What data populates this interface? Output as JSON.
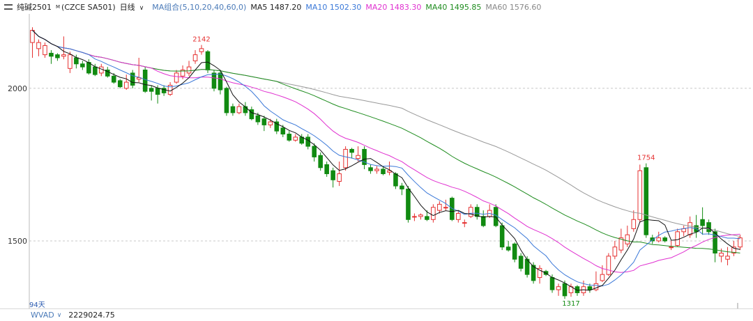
{
  "header": {
    "symbol": "纯碱2501",
    "symbol_mark": "M",
    "contract": "(CZCE SA501)",
    "period": "日线",
    "ma_group": "MA组合(5,10,20,40,60,0)",
    "ma5": "MA5 1487.20",
    "ma10": "MA10 1502.30",
    "ma20": "MA20 1483.30",
    "ma40": "MA40 1495.85",
    "ma60": "MA60 1576.60"
  },
  "footer": {
    "days": "94天",
    "indicator": "WVAD",
    "indicator_value": "2229024.75"
  },
  "colors": {
    "up": "#e53030",
    "down": "#118a11",
    "ma5": "#111111",
    "ma10": "#3a78d8",
    "ma20": "#e030d0",
    "ma40": "#1e8c1e",
    "ma60": "#999999",
    "grid": "#c8c8c8"
  },
  "chart_data": {
    "type": "candlestick",
    "title": "纯碱2501 (CZCE SA501) 日线",
    "y_ticks": [
      2000,
      1500
    ],
    "ylim": [
      1290,
      2230
    ],
    "grid": "dashed horizontal at ticks",
    "annotations": [
      {
        "text": "2142",
        "type": "high"
      },
      {
        "text": "1754",
        "type": "high"
      },
      {
        "text": "1317",
        "type": "low"
      }
    ],
    "candles": [
      [
        2150,
        2190,
        2100,
        2200
      ],
      [
        2130,
        2150,
        2105,
        2160
      ],
      [
        2110,
        2140,
        2100,
        2150
      ],
      [
        2115,
        2105,
        2080,
        2125
      ],
      [
        2110,
        2100,
        2090,
        2115
      ],
      [
        2105,
        2110,
        2095,
        2170
      ],
      [
        2065,
        2110,
        2050,
        2120
      ],
      [
        2100,
        2080,
        2065,
        2110
      ],
      [
        2080,
        2070,
        2060,
        2090
      ],
      [
        2085,
        2050,
        2045,
        2095
      ],
      [
        2070,
        2045,
        2040,
        2080
      ],
      [
        2050,
        2070,
        2040,
        2080
      ],
      [
        2060,
        2040,
        2035,
        2070
      ],
      [
        2040,
        2020,
        2015,
        2050
      ],
      [
        2025,
        2005,
        2000,
        2030
      ],
      [
        2000,
        2020,
        1995,
        2045
      ],
      [
        2050,
        2010,
        2000,
        2060
      ],
      [
        2030,
        2035,
        2020,
        2100
      ],
      [
        2060,
        1990,
        1985,
        2070
      ],
      [
        2000,
        1990,
        1960,
        2010
      ],
      [
        2000,
        1980,
        1950,
        2010
      ],
      [
        2000,
        1985,
        1975,
        2010
      ],
      [
        1980,
        2010,
        1975,
        2020
      ],
      [
        2020,
        2050,
        2015,
        2060
      ],
      [
        2040,
        2060,
        2030,
        2075
      ],
      [
        2050,
        2070,
        2040,
        2090
      ],
      [
        2090,
        2110,
        2080,
        2125
      ],
      [
        2120,
        2130,
        2110,
        2142
      ],
      [
        2120,
        2060,
        2050,
        2125
      ],
      [
        2050,
        2000,
        1990,
        2060
      ],
      [
        2050,
        1995,
        1980,
        2060
      ],
      [
        2000,
        1920,
        1910,
        2005
      ],
      [
        1940,
        1920,
        1910,
        1950
      ],
      [
        1920,
        1940,
        1915,
        1950
      ],
      [
        1940,
        1920,
        1910,
        1955
      ],
      [
        1930,
        1900,
        1895,
        1940
      ],
      [
        1910,
        1890,
        1880,
        1920
      ],
      [
        1900,
        1880,
        1860,
        1910
      ],
      [
        1880,
        1890,
        1870,
        1900
      ],
      [
        1890,
        1860,
        1850,
        1900
      ],
      [
        1870,
        1850,
        1840,
        1880
      ],
      [
        1850,
        1830,
        1825,
        1860
      ],
      [
        1830,
        1840,
        1825,
        1850
      ],
      [
        1840,
        1820,
        1815,
        1850
      ],
      [
        1840,
        1810,
        1800,
        1850
      ],
      [
        1810,
        1775,
        1760,
        1820
      ],
      [
        1780,
        1740,
        1730,
        1790
      ],
      [
        1750,
        1720,
        1710,
        1760
      ],
      [
        1730,
        1700,
        1675,
        1740
      ],
      [
        1695,
        1720,
        1680,
        1760
      ],
      [
        1740,
        1800,
        1730,
        1810
      ],
      [
        1800,
        1790,
        1770,
        1805
      ],
      [
        1770,
        1780,
        1760,
        1810
      ],
      [
        1800,
        1750,
        1735,
        1810
      ],
      [
        1740,
        1730,
        1720,
        1750
      ],
      [
        1730,
        1735,
        1720,
        1745
      ],
      [
        1735,
        1720,
        1715,
        1745
      ],
      [
        1725,
        1730,
        1715,
        1760
      ],
      [
        1720,
        1680,
        1670,
        1725
      ],
      [
        1680,
        1670,
        1650,
        1690
      ],
      [
        1670,
        1570,
        1560,
        1680
      ],
      [
        1580,
        1580,
        1565,
        1590
      ],
      [
        1580,
        1585,
        1570,
        1590
      ],
      [
        1580,
        1570,
        1565,
        1600
      ],
      [
        1570,
        1610,
        1560,
        1620
      ],
      [
        1600,
        1620,
        1590,
        1630
      ],
      [
        1610,
        1610,
        1600,
        1635
      ],
      [
        1640,
        1570,
        1565,
        1645
      ],
      [
        1570,
        1590,
        1560,
        1600
      ],
      [
        1560,
        1560,
        1545,
        1570
      ],
      [
        1580,
        1610,
        1575,
        1620
      ],
      [
        1610,
        1580,
        1570,
        1620
      ],
      [
        1580,
        1550,
        1545,
        1600
      ],
      [
        1580,
        1600,
        1575,
        1620
      ],
      [
        1610,
        1550,
        1545,
        1620
      ],
      [
        1550,
        1480,
        1470,
        1560
      ],
      [
        1480,
        1470,
        1465,
        1500
      ],
      [
        1490,
        1440,
        1430,
        1495
      ],
      [
        1450,
        1410,
        1400,
        1460
      ],
      [
        1440,
        1390,
        1380,
        1450
      ],
      [
        1420,
        1370,
        1360,
        1430
      ],
      [
        1380,
        1410,
        1360,
        1420
      ],
      [
        1400,
        1390,
        1385,
        1405
      ],
      [
        1380,
        1340,
        1330,
        1390
      ],
      [
        1340,
        1350,
        1320,
        1360
      ],
      [
        1360,
        1320,
        1310,
        1370
      ],
      [
        1330,
        1350,
        1317,
        1360
      ],
      [
        1350,
        1330,
        1320,
        1355
      ],
      [
        1330,
        1350,
        1320,
        1370
      ],
      [
        1350,
        1340,
        1330,
        1360
      ],
      [
        1340,
        1360,
        1335,
        1400
      ],
      [
        1370,
        1390,
        1365,
        1420
      ],
      [
        1390,
        1450,
        1385,
        1460
      ],
      [
        1450,
        1480,
        1440,
        1500
      ],
      [
        1470,
        1510,
        1460,
        1540
      ],
      [
        1490,
        1520,
        1480,
        1550
      ],
      [
        1540,
        1570,
        1530,
        1600
      ],
      [
        1570,
        1730,
        1560,
        1750
      ],
      [
        1740,
        1520,
        1510,
        1754
      ],
      [
        1510,
        1500,
        1490,
        1520
      ],
      [
        1500,
        1510,
        1495,
        1530
      ],
      [
        1510,
        1500,
        1495,
        1515
      ],
      [
        1480,
        1480,
        1470,
        1500
      ],
      [
        1485,
        1530,
        1480,
        1540
      ],
      [
        1530,
        1540,
        1515,
        1550
      ],
      [
        1520,
        1560,
        1510,
        1580
      ],
      [
        1550,
        1530,
        1510,
        1585
      ],
      [
        1570,
        1550,
        1520,
        1610
      ],
      [
        1560,
        1530,
        1520,
        1570
      ],
      [
        1530,
        1460,
        1430,
        1540
      ],
      [
        1450,
        1460,
        1430,
        1475
      ],
      [
        1440,
        1450,
        1420,
        1480
      ],
      [
        1460,
        1480,
        1450,
        1500
      ],
      [
        1480,
        1510,
        1470,
        1520
      ]
    ]
  }
}
